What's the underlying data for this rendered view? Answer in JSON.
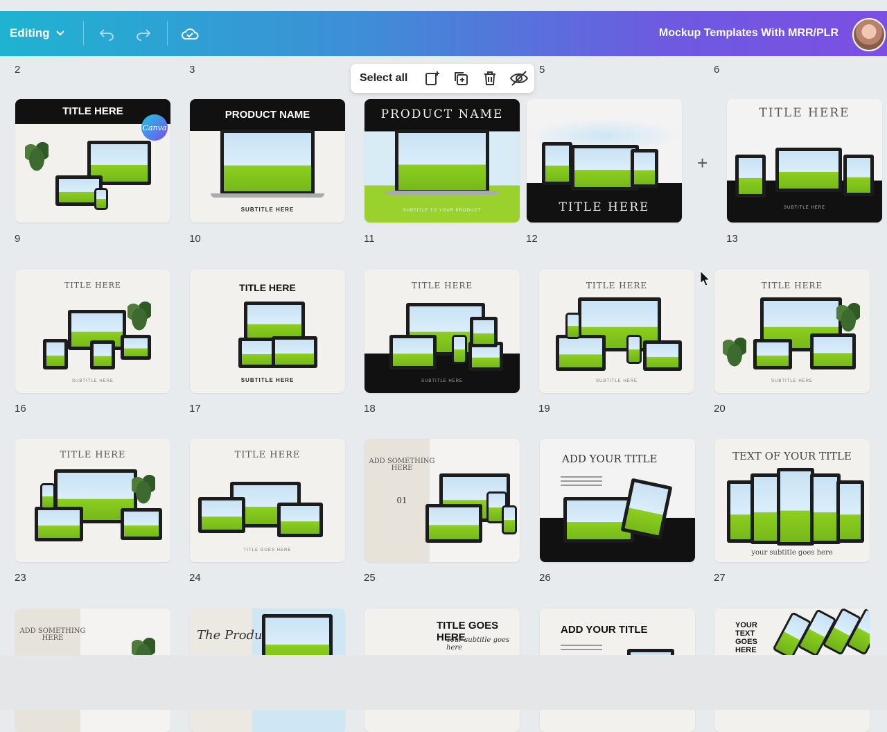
{
  "topbar": {
    "mode_label": "Editing",
    "document_title": "Mockup Templates With MRR/PLR"
  },
  "selection_toolbar": {
    "select_all_label": "Select all"
  },
  "rows": [
    {
      "labels": [
        "2",
        "3",
        "5",
        "6"
      ]
    },
    {
      "labels": [
        "9",
        "10",
        "11",
        "12",
        "13"
      ]
    },
    {
      "labels": [
        "16",
        "17",
        "18",
        "19",
        "20"
      ]
    },
    {
      "labels": [
        "23",
        "24",
        "25",
        "26",
        "27"
      ]
    }
  ],
  "thumbnails": {
    "t1": {
      "title": "TITLE HERE",
      "badge": "Canva"
    },
    "t2": {
      "title": "PRODUCT NAME",
      "subtitle": "SUBTITLE HERE"
    },
    "t3": {
      "title": "PRODUCT NAME",
      "subtitle": "SUBTITLE TO YOUR PRODUCT"
    },
    "t4": {
      "title": "TITLE HERE"
    },
    "t5": {
      "title": "TITLE HERE",
      "subtitle": "SUBTITLE HERE"
    },
    "t6": {
      "title": "TITLE HERE",
      "subtitle": "SUBTITLE HERE"
    },
    "t7": {
      "title": "TITLE HERE",
      "subtitle": "SUBTITLE HERE"
    },
    "t8": {
      "title": "TITLE HERE",
      "subtitle": "SUBTITLE HERE"
    },
    "t9": {
      "title": "TITLE HERE",
      "subtitle": "SUBTITLE HERE"
    },
    "t10": {
      "title": "TITLE HERE",
      "subtitle": "SUBTITLE HERE"
    },
    "t11": {
      "title": "TITLE HERE"
    },
    "t12": {
      "title": "TITLE HERE",
      "subtitle": "TITLE GOES HERE"
    },
    "t13": {
      "title": "ADD SOMETHING HERE",
      "number": "01"
    },
    "t14": {
      "title": "ADD YOUR TITLE"
    },
    "t15": {
      "title": "TEXT OF YOUR TITLE",
      "subtitle": "your subtitle goes here"
    },
    "t16": {
      "title": "ADD SOMETHING HERE"
    },
    "t17": {
      "title": "The Product"
    },
    "t18": {
      "title": "TITLE GOES HERE",
      "subtitle": "Your subtitle goes here"
    },
    "t19": {
      "title": "ADD YOUR TITLE"
    },
    "t20": {
      "title": "YOUR TEXT GOES HERE"
    }
  },
  "colors": {
    "accent_start": "#1fb3d1",
    "accent_end": "#7c4fe3",
    "screen_green": "#8ccf1e"
  },
  "icons": [
    "chevron-down-icon",
    "undo-icon",
    "redo-icon",
    "cloud-saved-icon",
    "add-page-icon",
    "duplicate-icon",
    "trash-icon",
    "hide-icon",
    "plus-icon",
    "cursor-icon"
  ]
}
